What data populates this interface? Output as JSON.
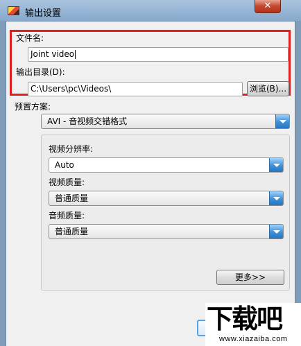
{
  "window": {
    "title": "输出设置",
    "close_symbol": "✕"
  },
  "file": {
    "name_label": "文件名:",
    "name_value": "Joint video",
    "dir_label": "输出目录(D):",
    "dir_value": "C:\\Users\\pc\\Videos\\",
    "browse_label": "浏览(B)..."
  },
  "preset": {
    "label": "预置方案:",
    "selected": "AVI - 音视频交错格式"
  },
  "settings": {
    "resolution_label": "视频分辨率:",
    "resolution_value": "Auto",
    "video_quality_label": "视频质量:",
    "video_quality_value": "普通质量",
    "audio_quality_label": "音频质量:",
    "audio_quality_value": "普通质量",
    "more_label": "更多>>"
  },
  "watermark": {
    "chars": "下载吧",
    "url": "www.xiazaiba.com"
  },
  "colors": {
    "highlight": "#e01d1d",
    "accent": "#3d8fd8"
  }
}
